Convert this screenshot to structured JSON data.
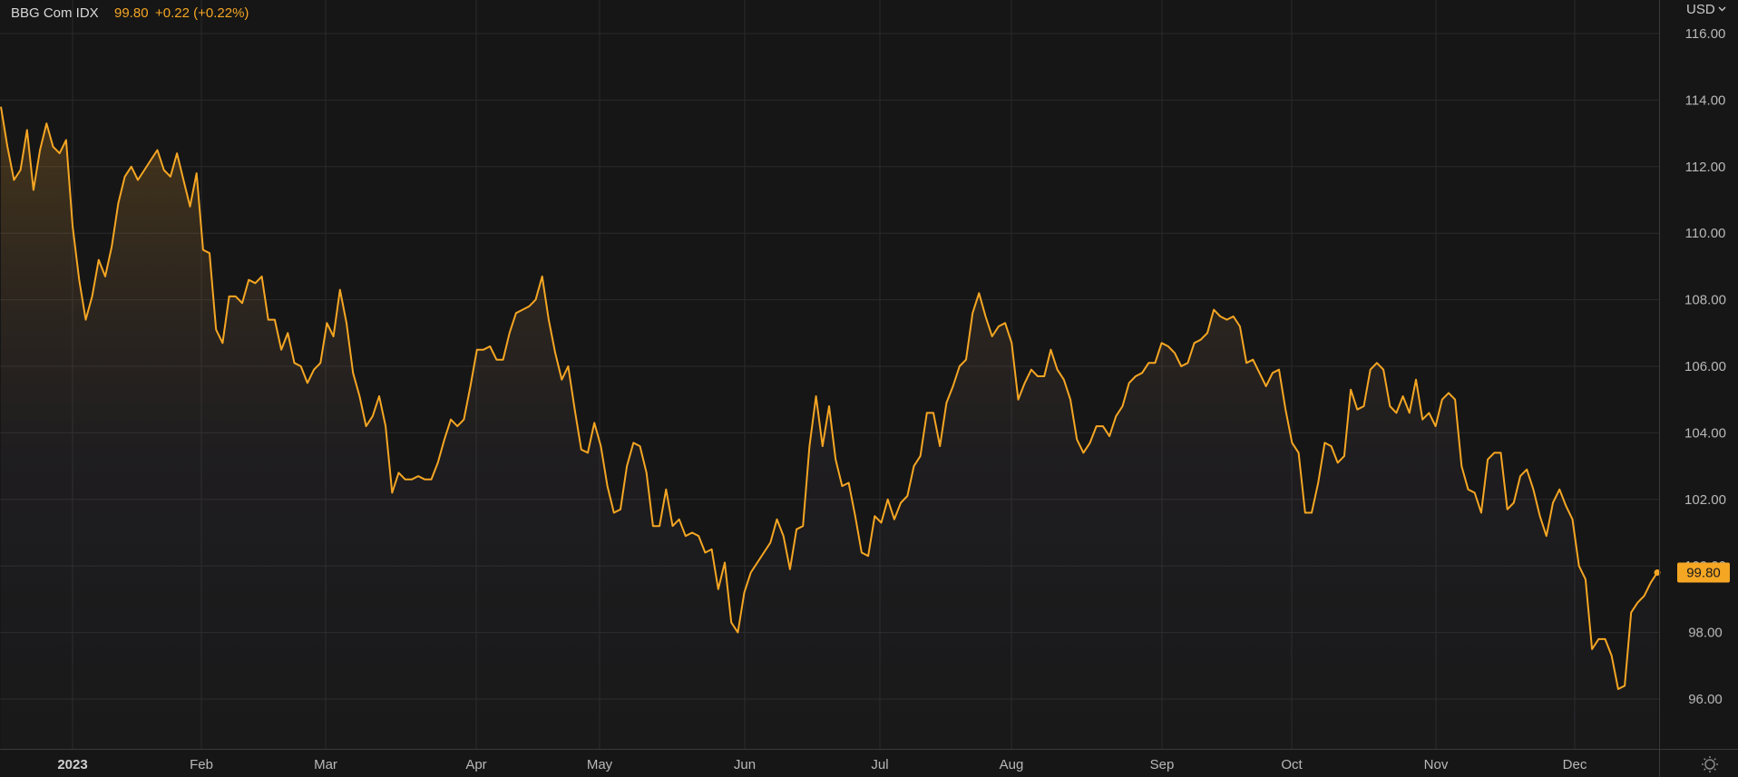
{
  "legend": {
    "name": "BBG Com IDX",
    "last": "99.80",
    "change": "+0.22 (+0.22%)"
  },
  "currency_label": "USD",
  "last_badge": "99.80",
  "colors": {
    "line": "#f5a623",
    "background": "#161616",
    "grid": "#2a2a2a",
    "badge": "#f5a623"
  },
  "icons": [
    "chevron-down-icon",
    "settings-sun-icon"
  ],
  "chart_data": {
    "type": "line",
    "title": "",
    "series": [
      {
        "name": "BBG Com IDX",
        "values": [
          113.8,
          112.6,
          111.6,
          111.9,
          113.1,
          111.3,
          112.5,
          113.3,
          112.6,
          112.4,
          112.8,
          110.2,
          108.6,
          107.4,
          108.1,
          109.2,
          108.7,
          109.6,
          110.9,
          111.7,
          112.0,
          111.6,
          111.9,
          112.2,
          112.5,
          111.9,
          111.7,
          112.4,
          111.6,
          110.8,
          111.8,
          109.5,
          109.4,
          107.1,
          106.7,
          108.1,
          108.1,
          107.9,
          108.6,
          108.5,
          108.7,
          107.4,
          107.4,
          106.5,
          107.0,
          106.1,
          106.0,
          105.5,
          105.9,
          106.1,
          107.3,
          106.9,
          108.3,
          107.3,
          105.8,
          105.1,
          104.2,
          104.5,
          105.1,
          104.2,
          102.2,
          102.8,
          102.6,
          102.6,
          102.7,
          102.6,
          102.6,
          103.1,
          103.8,
          104.4,
          104.2,
          104.4,
          105.4,
          106.5,
          106.5,
          106.6,
          106.2,
          106.2,
          107.0,
          107.6,
          107.7,
          107.8,
          108.0,
          108.7,
          107.4,
          106.4,
          105.6,
          106.0,
          104.7,
          103.5,
          103.4,
          104.3,
          103.6,
          102.4,
          101.6,
          101.7,
          103.0,
          103.7,
          103.6,
          102.8,
          101.2,
          101.2,
          102.3,
          101.2,
          101.4,
          100.9,
          101.0,
          100.9,
          100.4,
          100.5,
          99.3,
          100.1,
          98.3,
          98.0,
          99.2,
          99.8,
          100.1,
          100.4,
          100.7,
          101.4,
          100.9,
          99.9,
          101.1,
          101.2,
          103.6,
          105.1,
          103.6,
          104.8,
          103.2,
          102.4,
          102.5,
          101.5,
          100.4,
          100.3,
          101.5,
          101.3,
          102.0,
          101.4,
          101.9,
          102.1,
          103.0,
          103.3,
          104.6,
          104.6,
          103.6,
          104.9,
          105.4,
          106.0,
          106.2,
          107.6,
          108.2,
          107.5,
          106.9,
          107.2,
          107.3,
          106.7,
          105.0,
          105.5,
          105.9,
          105.7,
          105.7,
          106.5,
          105.9,
          105.6,
          105.0,
          103.8,
          103.4,
          103.7,
          104.2,
          104.2,
          103.9,
          104.5,
          104.8,
          105.5,
          105.7,
          105.8,
          106.1,
          106.1,
          106.7,
          106.6,
          106.4,
          106.0,
          106.1,
          106.7,
          106.8,
          107.0,
          107.7,
          107.5,
          107.4,
          107.5,
          107.2,
          106.1,
          106.2,
          105.8,
          105.4,
          105.8,
          105.9,
          104.7,
          103.7,
          103.4,
          101.6,
          101.6,
          102.5,
          103.7,
          103.6,
          103.1,
          103.3,
          105.3,
          104.7,
          104.8,
          105.9,
          106.1,
          105.9,
          104.8,
          104.6,
          105.1,
          104.6,
          105.6,
          104.4,
          104.6,
          104.2,
          105.0,
          105.2,
          105.0,
          103.0,
          102.3,
          102.2,
          101.6,
          103.2,
          103.4,
          103.4,
          101.7,
          101.9,
          102.7,
          102.9,
          102.3,
          101.5,
          100.9,
          101.9,
          102.3,
          101.8,
          101.4,
          100.0,
          99.6,
          97.5,
          97.8,
          97.8,
          97.3,
          96.3,
          96.4,
          98.6,
          98.9,
          99.1,
          99.5,
          99.8
        ]
      }
    ],
    "x_tick_labels": [
      "2023",
      "Feb",
      "Mar",
      "Apr",
      "May",
      "Jun",
      "Jul",
      "Aug",
      "Sep",
      "Oct",
      "Nov",
      "Dec"
    ],
    "y_tick_labels": [
      "116.00",
      "114.00",
      "112.00",
      "110.00",
      "108.00",
      "106.00",
      "104.00",
      "102.00",
      "100.00",
      "98.00",
      "96.00"
    ],
    "ylim": [
      95.0,
      116.5
    ],
    "y_axis_side": "right",
    "grid": true,
    "legend_position": "top-left",
    "last_value": 99.8
  }
}
